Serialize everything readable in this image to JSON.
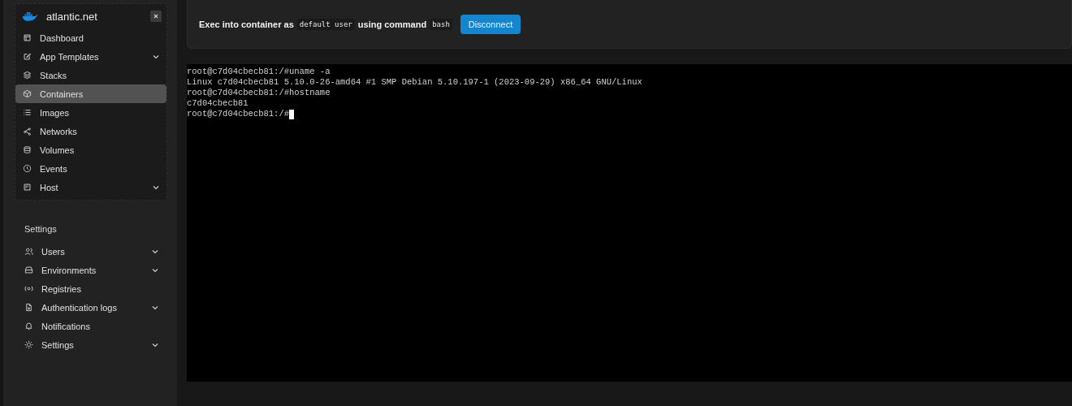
{
  "sidebar": {
    "brand": "atlantic.net",
    "items": [
      {
        "label": "Dashboard",
        "selected": false,
        "expandable": false
      },
      {
        "label": "App Templates",
        "selected": false,
        "expandable": true
      },
      {
        "label": "Stacks",
        "selected": false,
        "expandable": false
      },
      {
        "label": "Containers",
        "selected": true,
        "expandable": false
      },
      {
        "label": "Images",
        "selected": false,
        "expandable": false
      },
      {
        "label": "Networks",
        "selected": false,
        "expandable": false
      },
      {
        "label": "Volumes",
        "selected": false,
        "expandable": false
      },
      {
        "label": "Events",
        "selected": false,
        "expandable": false
      },
      {
        "label": "Host",
        "selected": false,
        "expandable": true
      }
    ],
    "section_title": "Settings",
    "settings_items": [
      {
        "label": "Users",
        "selected": false,
        "expandable": true
      },
      {
        "label": "Environments",
        "selected": false,
        "expandable": true
      },
      {
        "label": "Registries",
        "selected": false,
        "expandable": false
      },
      {
        "label": "Authentication logs",
        "selected": false,
        "expandable": true
      },
      {
        "label": "Notifications",
        "selected": false,
        "expandable": false
      },
      {
        "label": "Settings",
        "selected": false,
        "expandable": true
      }
    ]
  },
  "exec_bar": {
    "parts": [
      {
        "kind": "text",
        "text": "Exec into container as"
      },
      {
        "kind": "code",
        "text": "default user"
      },
      {
        "kind": "text",
        "text": "using command"
      },
      {
        "kind": "code",
        "text": "bash"
      }
    ],
    "button": "Disconnect"
  },
  "terminal": {
    "lines": [
      "root@c7d04cbecb81:/#uname -a",
      "Linux c7d04cbecb81 5.10.0-26-amd64 #1 SMP Debian 5.10.197-1 (2023-09-29) x86_64 GNU/Linux",
      "root@c7d04cbecb81:/#hostname",
      "c7d04cbecb81",
      "root@c7d04cbecb81:/#"
    ],
    "cursor": true
  }
}
